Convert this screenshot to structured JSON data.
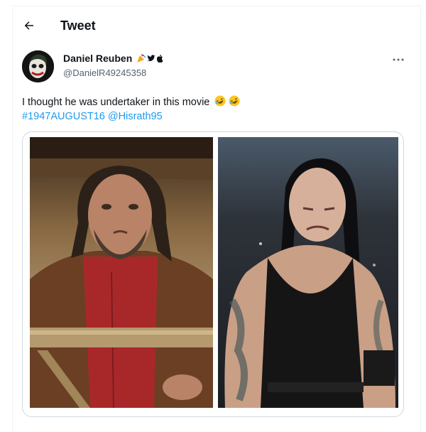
{
  "header": {
    "title": "Tweet"
  },
  "author": {
    "display_name": "Daniel Reuben",
    "handle": "@DanielR49245358"
  },
  "tweet": {
    "text": "I thought he was undertaker in this movie",
    "hashtag": "#1947AUGUST16",
    "mention": "@Hisrath95"
  },
  "icons": {
    "back": "arrow-left-icon",
    "more": "more-horizontal-icon",
    "emoji": "rolling-on-floor-laughing-emoji",
    "badges": [
      "party-emoji",
      "twitter-bird-icon",
      "apple-icon"
    ]
  },
  "colors": {
    "link": "#1d9bf0",
    "secondary_text": "#536471",
    "border": "#cfd9de"
  }
}
